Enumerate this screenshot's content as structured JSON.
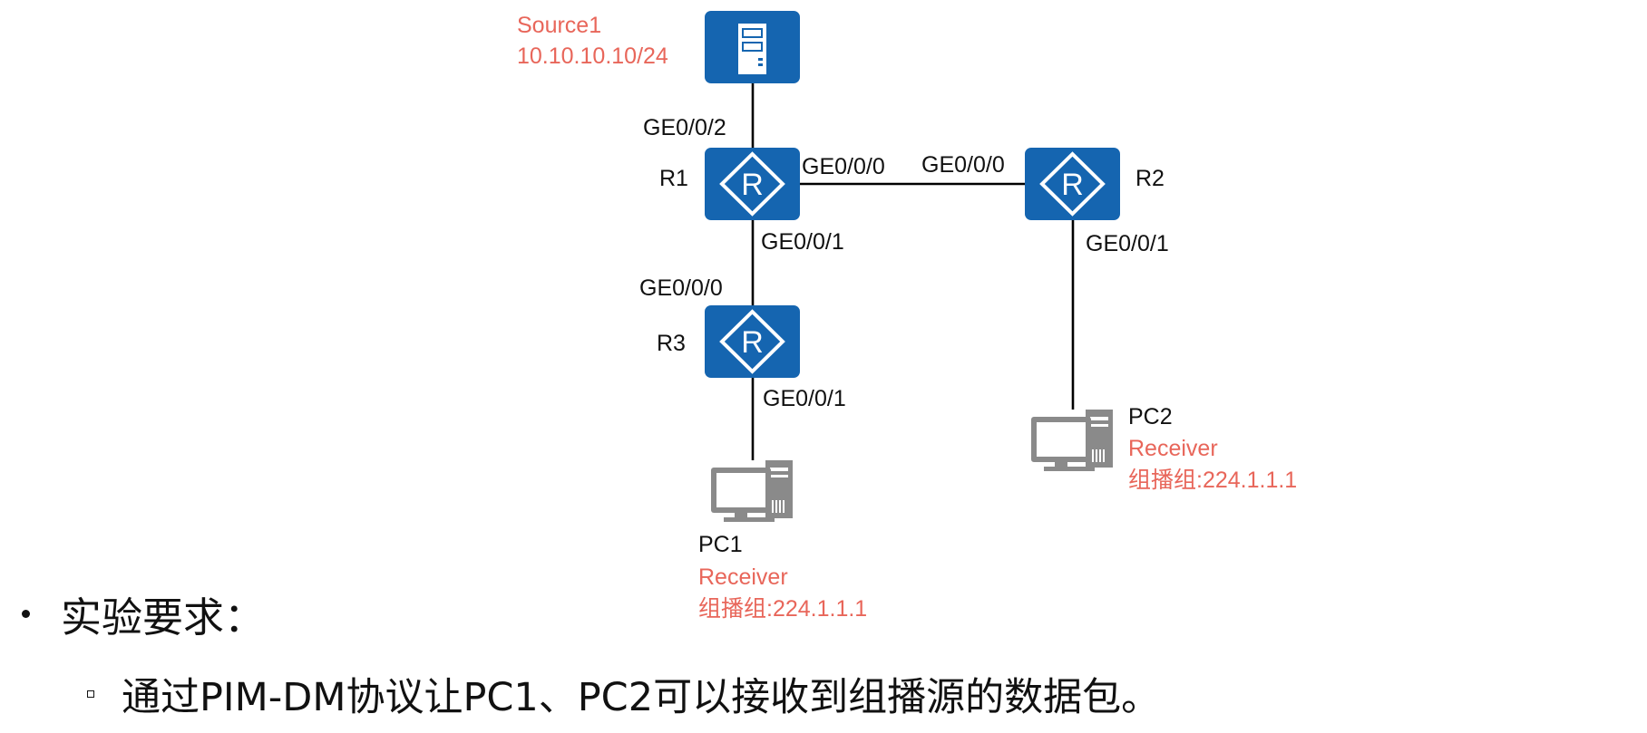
{
  "colors": {
    "device_blue": "#1565b0",
    "pc_gray": "#8a8a8a",
    "highlight_red": "#e8665a"
  },
  "nodes": {
    "source": {
      "name": "Source1",
      "ip": "10.10.10.10/24",
      "icon": "server-icon"
    },
    "r1": {
      "name": "R1",
      "icon": "router-icon"
    },
    "r2": {
      "name": "R2",
      "icon": "router-icon"
    },
    "r3": {
      "name": "R3",
      "icon": "router-icon"
    },
    "pc1": {
      "name": "PC1",
      "role": "Receiver",
      "group": "组播组:224.1.1.1",
      "icon": "pc-icon"
    },
    "pc2": {
      "name": "PC2",
      "role": "Receiver",
      "group": "组播组:224.1.1.1",
      "icon": "pc-icon"
    }
  },
  "interfaces": {
    "r1_to_source": "GE0/0/2",
    "r1_to_r2": "GE0/0/0",
    "r2_to_r1": "GE0/0/0",
    "r1_to_r3": "GE0/0/1",
    "r3_to_r1": "GE0/0/0",
    "r3_to_pc1": "GE0/0/1",
    "r2_to_pc2": "GE0/0/1"
  },
  "requirements": {
    "heading": "实验要求：",
    "items": [
      "通过PIM-DM协议让PC1、PC2可以接收到组播源的数据包。"
    ]
  }
}
